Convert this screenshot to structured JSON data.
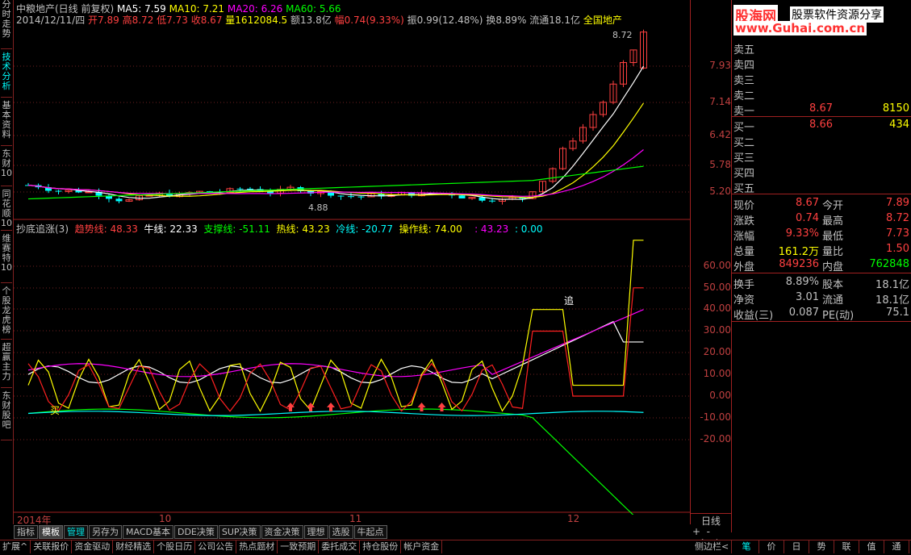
{
  "sidebar": {
    "tabs": [
      "分时走势",
      "技术分析",
      "基本资料",
      "东财10",
      "同花顺10",
      "维赛特10",
      "个股龙虎榜",
      "超赢主力",
      "东财股吧"
    ]
  },
  "header": {
    "title": "中粮地产(日线 前复权)",
    "ma5": "MA5: 7.59",
    "ma10": "MA10: 7.21",
    "ma20": "MA20: 6.26",
    "ma60": "MA60: 5.66",
    "info_date": "2014/12/11/四",
    "info_open": "开7.89",
    "info_high": "高8.72",
    "info_low": "低7.73",
    "info_close": "收8.67",
    "info_vol": "量1612084.5",
    "info_amt": "额13.8亿",
    "info_range": "幅0.74(9.33%)",
    "info_amp": "振0.99(12.48%)",
    "info_turn": "换8.89%",
    "info_float": "流通18.1亿",
    "info_sector": "全国地产",
    "high_mark": "8.72",
    "low_mark": "4.88"
  },
  "indicator": {
    "name": "抄底追涨(3)",
    "trend": "趋势线: 48.33",
    "bull": "牛线: 22.33",
    "support": "支撑线: -51.11",
    "hot": "热线: 43.23",
    "cold": "冷线: -20.77",
    "operate": "操作线: 74.00",
    "v1": ": 43.23",
    "v2": ": 0.00",
    "zhui": "追",
    "mai": "买"
  },
  "upper_axis": [
    "7.93",
    "7.14",
    "6.42",
    "5.78",
    "5.20"
  ],
  "lower_axis": [
    "60.00",
    "50.00",
    "40.00",
    "30.00",
    "20.00",
    "10.00",
    "0.00",
    "-10.00",
    "-20.00"
  ],
  "x_axis": [
    "2014年",
    "10",
    "11",
    "12"
  ],
  "period_label": "日线",
  "logo": {
    "brand": "股海网",
    "slogan": "股票软件资源分享",
    "url": "www.Guhai.com.cn"
  },
  "orderbook": {
    "sells": [
      {
        "label": "卖五",
        "price": "",
        "vol": ""
      },
      {
        "label": "卖四",
        "price": "",
        "vol": ""
      },
      {
        "label": "卖三",
        "price": "",
        "vol": ""
      },
      {
        "label": "卖二",
        "price": "",
        "vol": ""
      },
      {
        "label": "卖一",
        "price": "8.67",
        "vol": "8150"
      }
    ],
    "buys": [
      {
        "label": "买一",
        "price": "8.66",
        "vol": "434"
      },
      {
        "label": "买二",
        "price": "",
        "vol": ""
      },
      {
        "label": "买三",
        "price": "",
        "vol": ""
      },
      {
        "label": "买四",
        "price": "",
        "vol": ""
      },
      {
        "label": "买五",
        "price": "",
        "vol": ""
      }
    ]
  },
  "quote": [
    {
      "l1": "现价",
      "v1": "8.67",
      "c1": "#ff4040",
      "l2": "今开",
      "v2": "7.89",
      "c2": "#ff4040"
    },
    {
      "l1": "涨跌",
      "v1": "0.74",
      "c1": "#ff4040",
      "l2": "最高",
      "v2": "8.72",
      "c2": "#ff4040"
    },
    {
      "l1": "涨幅",
      "v1": "9.33%",
      "c1": "#ff4040",
      "l2": "最低",
      "v2": "7.73",
      "c2": "#ff4040"
    },
    {
      "l1": "总量",
      "v1": "161.2万",
      "c1": "#ffff00",
      "l2": "量比",
      "v2": "1.50",
      "c2": "#ff4040"
    },
    {
      "l1": "外盘",
      "v1": "849236",
      "c1": "#ff4040",
      "l2": "内盘",
      "v2": "762848",
      "c2": "#00ff00"
    }
  ],
  "stats": [
    {
      "l1": "换手",
      "v1": "8.89%",
      "l2": "股本",
      "v2": "18.1亿"
    },
    {
      "l1": "净资",
      "v1": "3.01",
      "l2": "流通",
      "v2": "18.1亿"
    },
    {
      "l1": "收益(三)",
      "v1": "0.087",
      "l2": "PE(动)",
      "v2": "75.1"
    }
  ],
  "bottom_tabs": [
    "指标",
    "模板",
    "管理",
    "另存为",
    "MACD基本",
    "DDE决策",
    "SUP决策",
    "资金决策",
    "理想",
    "选股",
    "牛起点"
  ],
  "statusbar": [
    "扩展^",
    "关联报价",
    "资金驱动",
    "财经精选",
    "个股日历",
    "公司公告",
    "热点题材",
    "一致预期",
    "委托成交",
    "持仓股份",
    "帐户资金",
    "侧边栏<"
  ],
  "right_status": [
    "笔",
    "价",
    "日",
    "势",
    "联",
    "值",
    "通"
  ],
  "colors": {
    "up": "#ff4040",
    "down": "#00ffff",
    "ma5": "#ffffff",
    "ma10": "#ffff00",
    "ma20": "#ff00ff",
    "ma60": "#00ff00",
    "frame": "#a02020"
  }
}
